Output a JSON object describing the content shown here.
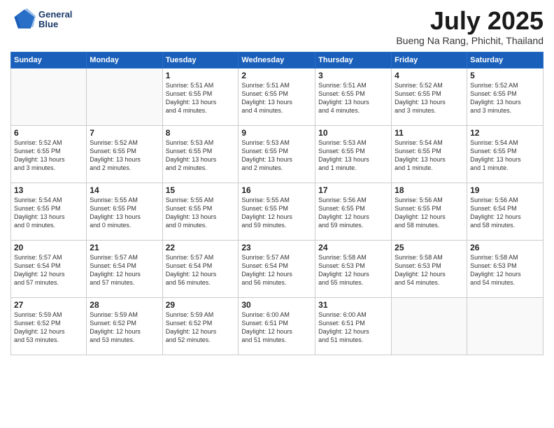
{
  "logo": {
    "line1": "General",
    "line2": "Blue"
  },
  "title": "July 2025",
  "subtitle": "Bueng Na Rang, Phichit, Thailand",
  "weekdays": [
    "Sunday",
    "Monday",
    "Tuesday",
    "Wednesday",
    "Thursday",
    "Friday",
    "Saturday"
  ],
  "weeks": [
    [
      {
        "day": "",
        "info": ""
      },
      {
        "day": "",
        "info": ""
      },
      {
        "day": "1",
        "info": "Sunrise: 5:51 AM\nSunset: 6:55 PM\nDaylight: 13 hours\nand 4 minutes."
      },
      {
        "day": "2",
        "info": "Sunrise: 5:51 AM\nSunset: 6:55 PM\nDaylight: 13 hours\nand 4 minutes."
      },
      {
        "day": "3",
        "info": "Sunrise: 5:51 AM\nSunset: 6:55 PM\nDaylight: 13 hours\nand 4 minutes."
      },
      {
        "day": "4",
        "info": "Sunrise: 5:52 AM\nSunset: 6:55 PM\nDaylight: 13 hours\nand 3 minutes."
      },
      {
        "day": "5",
        "info": "Sunrise: 5:52 AM\nSunset: 6:55 PM\nDaylight: 13 hours\nand 3 minutes."
      }
    ],
    [
      {
        "day": "6",
        "info": "Sunrise: 5:52 AM\nSunset: 6:55 PM\nDaylight: 13 hours\nand 3 minutes."
      },
      {
        "day": "7",
        "info": "Sunrise: 5:52 AM\nSunset: 6:55 PM\nDaylight: 13 hours\nand 2 minutes."
      },
      {
        "day": "8",
        "info": "Sunrise: 5:53 AM\nSunset: 6:55 PM\nDaylight: 13 hours\nand 2 minutes."
      },
      {
        "day": "9",
        "info": "Sunrise: 5:53 AM\nSunset: 6:55 PM\nDaylight: 13 hours\nand 2 minutes."
      },
      {
        "day": "10",
        "info": "Sunrise: 5:53 AM\nSunset: 6:55 PM\nDaylight: 13 hours\nand 1 minute."
      },
      {
        "day": "11",
        "info": "Sunrise: 5:54 AM\nSunset: 6:55 PM\nDaylight: 13 hours\nand 1 minute."
      },
      {
        "day": "12",
        "info": "Sunrise: 5:54 AM\nSunset: 6:55 PM\nDaylight: 13 hours\nand 1 minute."
      }
    ],
    [
      {
        "day": "13",
        "info": "Sunrise: 5:54 AM\nSunset: 6:55 PM\nDaylight: 13 hours\nand 0 minutes."
      },
      {
        "day": "14",
        "info": "Sunrise: 5:55 AM\nSunset: 6:55 PM\nDaylight: 13 hours\nand 0 minutes."
      },
      {
        "day": "15",
        "info": "Sunrise: 5:55 AM\nSunset: 6:55 PM\nDaylight: 13 hours\nand 0 minutes."
      },
      {
        "day": "16",
        "info": "Sunrise: 5:55 AM\nSunset: 6:55 PM\nDaylight: 12 hours\nand 59 minutes."
      },
      {
        "day": "17",
        "info": "Sunrise: 5:56 AM\nSunset: 6:55 PM\nDaylight: 12 hours\nand 59 minutes."
      },
      {
        "day": "18",
        "info": "Sunrise: 5:56 AM\nSunset: 6:55 PM\nDaylight: 12 hours\nand 58 minutes."
      },
      {
        "day": "19",
        "info": "Sunrise: 5:56 AM\nSunset: 6:54 PM\nDaylight: 12 hours\nand 58 minutes."
      }
    ],
    [
      {
        "day": "20",
        "info": "Sunrise: 5:57 AM\nSunset: 6:54 PM\nDaylight: 12 hours\nand 57 minutes."
      },
      {
        "day": "21",
        "info": "Sunrise: 5:57 AM\nSunset: 6:54 PM\nDaylight: 12 hours\nand 57 minutes."
      },
      {
        "day": "22",
        "info": "Sunrise: 5:57 AM\nSunset: 6:54 PM\nDaylight: 12 hours\nand 56 minutes."
      },
      {
        "day": "23",
        "info": "Sunrise: 5:57 AM\nSunset: 6:54 PM\nDaylight: 12 hours\nand 56 minutes."
      },
      {
        "day": "24",
        "info": "Sunrise: 5:58 AM\nSunset: 6:53 PM\nDaylight: 12 hours\nand 55 minutes."
      },
      {
        "day": "25",
        "info": "Sunrise: 5:58 AM\nSunset: 6:53 PM\nDaylight: 12 hours\nand 54 minutes."
      },
      {
        "day": "26",
        "info": "Sunrise: 5:58 AM\nSunset: 6:53 PM\nDaylight: 12 hours\nand 54 minutes."
      }
    ],
    [
      {
        "day": "27",
        "info": "Sunrise: 5:59 AM\nSunset: 6:52 PM\nDaylight: 12 hours\nand 53 minutes."
      },
      {
        "day": "28",
        "info": "Sunrise: 5:59 AM\nSunset: 6:52 PM\nDaylight: 12 hours\nand 53 minutes."
      },
      {
        "day": "29",
        "info": "Sunrise: 5:59 AM\nSunset: 6:52 PM\nDaylight: 12 hours\nand 52 minutes."
      },
      {
        "day": "30",
        "info": "Sunrise: 6:00 AM\nSunset: 6:51 PM\nDaylight: 12 hours\nand 51 minutes."
      },
      {
        "day": "31",
        "info": "Sunrise: 6:00 AM\nSunset: 6:51 PM\nDaylight: 12 hours\nand 51 minutes."
      },
      {
        "day": "",
        "info": ""
      },
      {
        "day": "",
        "info": ""
      }
    ]
  ]
}
